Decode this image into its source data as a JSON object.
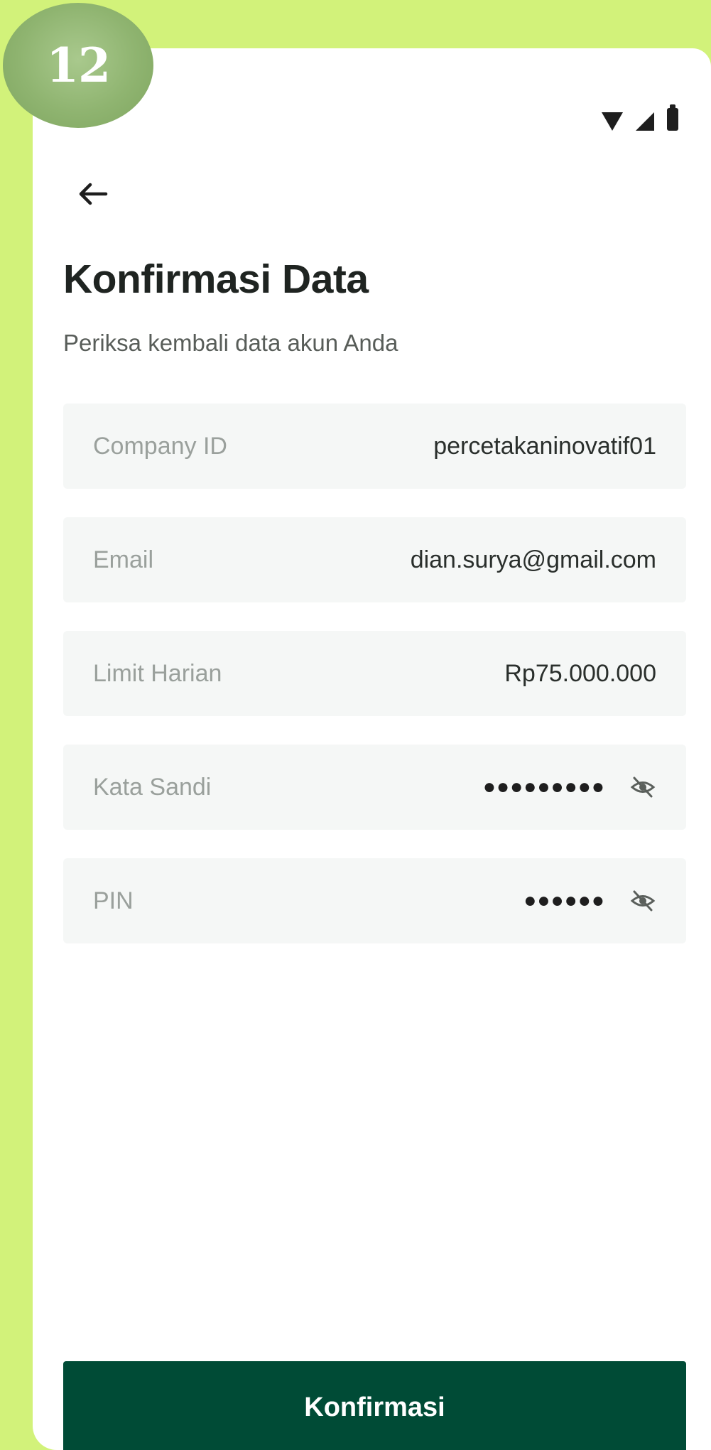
{
  "step": "12",
  "header": {
    "title": "Konfirmasi Data",
    "subtitle": "Periksa kembali data akun Anda"
  },
  "fields": [
    {
      "label": "Company ID",
      "value": "percetakaninovatif01"
    },
    {
      "label": "Email",
      "value": "dian.surya@gmail.com"
    },
    {
      "label": "Limit Harian",
      "value": "Rp75.000.000"
    },
    {
      "label": "Kata Sandi",
      "value": "●●●●●●●●●",
      "hidden": true
    },
    {
      "label": "PIN",
      "value": "●●●●●●",
      "hidden": true
    }
  ],
  "icons": {
    "back": "arrow-left-icon",
    "toggle": "eye-off-icon",
    "status": [
      "wifi-icon",
      "signal-icon",
      "battery-icon"
    ]
  },
  "confirm_label": "Konfirmasi",
  "colors": {
    "background": "#d2f27a",
    "primary": "#004b36",
    "badge": "#8fb470",
    "row_bg": "#f5f7f6"
  }
}
